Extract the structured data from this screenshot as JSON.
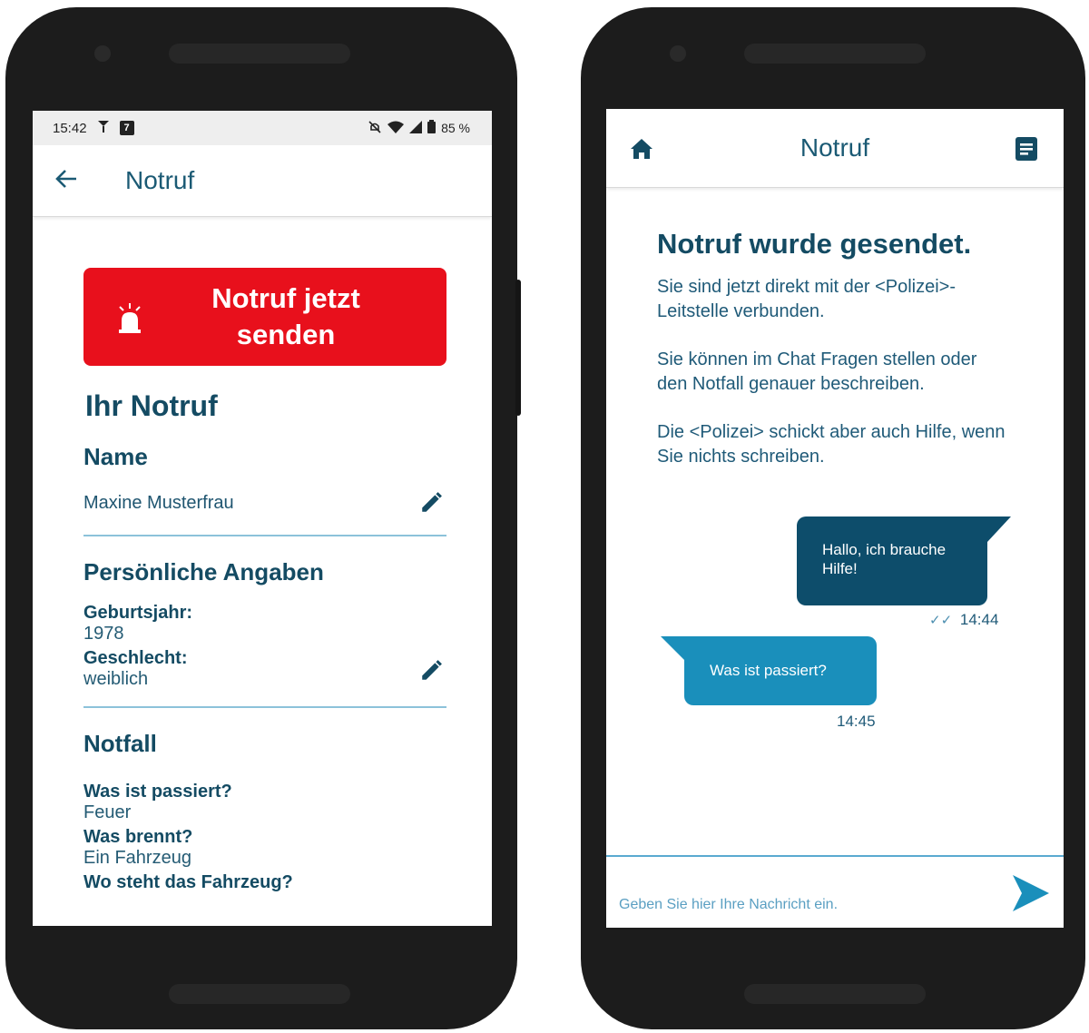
{
  "left_phone": {
    "status_bar": {
      "time": "15:42",
      "calendar_badge": "7",
      "battery": "85 %"
    },
    "appbar": {
      "back_icon": "arrow-left-icon",
      "title": "Notruf"
    },
    "sos_button": {
      "label": "Notruf jetzt senden",
      "icon": "siren-icon",
      "color": "#e8101c"
    },
    "heading": "Ihr Notruf",
    "name_section": {
      "title": "Name",
      "value": "Maxine Musterfrau",
      "edit_icon": "pencil-icon"
    },
    "personal_section": {
      "title": "Persönliche Angaben",
      "birth_label": "Geburtsjahr:",
      "birth_value": "1978",
      "gender_label": "Geschlecht:",
      "gender_value": "weiblich",
      "edit_icon": "pencil-icon"
    },
    "emergency_section": {
      "title": "Notfall",
      "q1_label": "Was ist passiert?",
      "q1_value": "Feuer",
      "q2_label": "Was brennt?",
      "q2_value": "Ein Fahrzeug",
      "q3_label": "Wo steht das Fahrzeug?"
    }
  },
  "right_phone": {
    "appbar": {
      "home_icon": "home-icon",
      "title": "Notruf",
      "doc_icon": "document-icon"
    },
    "confirmation": {
      "title": "Notruf wurde gesendet.",
      "p1": "Sie sind jetzt direkt mit der <Polizei>-Leitstelle verbunden.",
      "p2": "Sie können im Chat Fragen stellen oder den Notfall genauer beschreiben.",
      "p3": "Die <Polizei> schickt aber auch Hilfe, wenn Sie nichts schreiben."
    },
    "chat": {
      "outgoing": {
        "text": "Hallo, ich brauche Hilfe!",
        "time": "14:44",
        "status_icon": "double-check-icon"
      },
      "incoming": {
        "text": "Was ist passiert?",
        "time": "14:45"
      }
    },
    "composer": {
      "placeholder": "Geben Sie hier Ihre Nachricht ein.",
      "send_icon": "send-icon"
    }
  },
  "colors": {
    "primary_text": "#144b63",
    "alert_red": "#e8101c",
    "bubble_out": "#0d4d6b",
    "bubble_in": "#1a8fbb"
  }
}
